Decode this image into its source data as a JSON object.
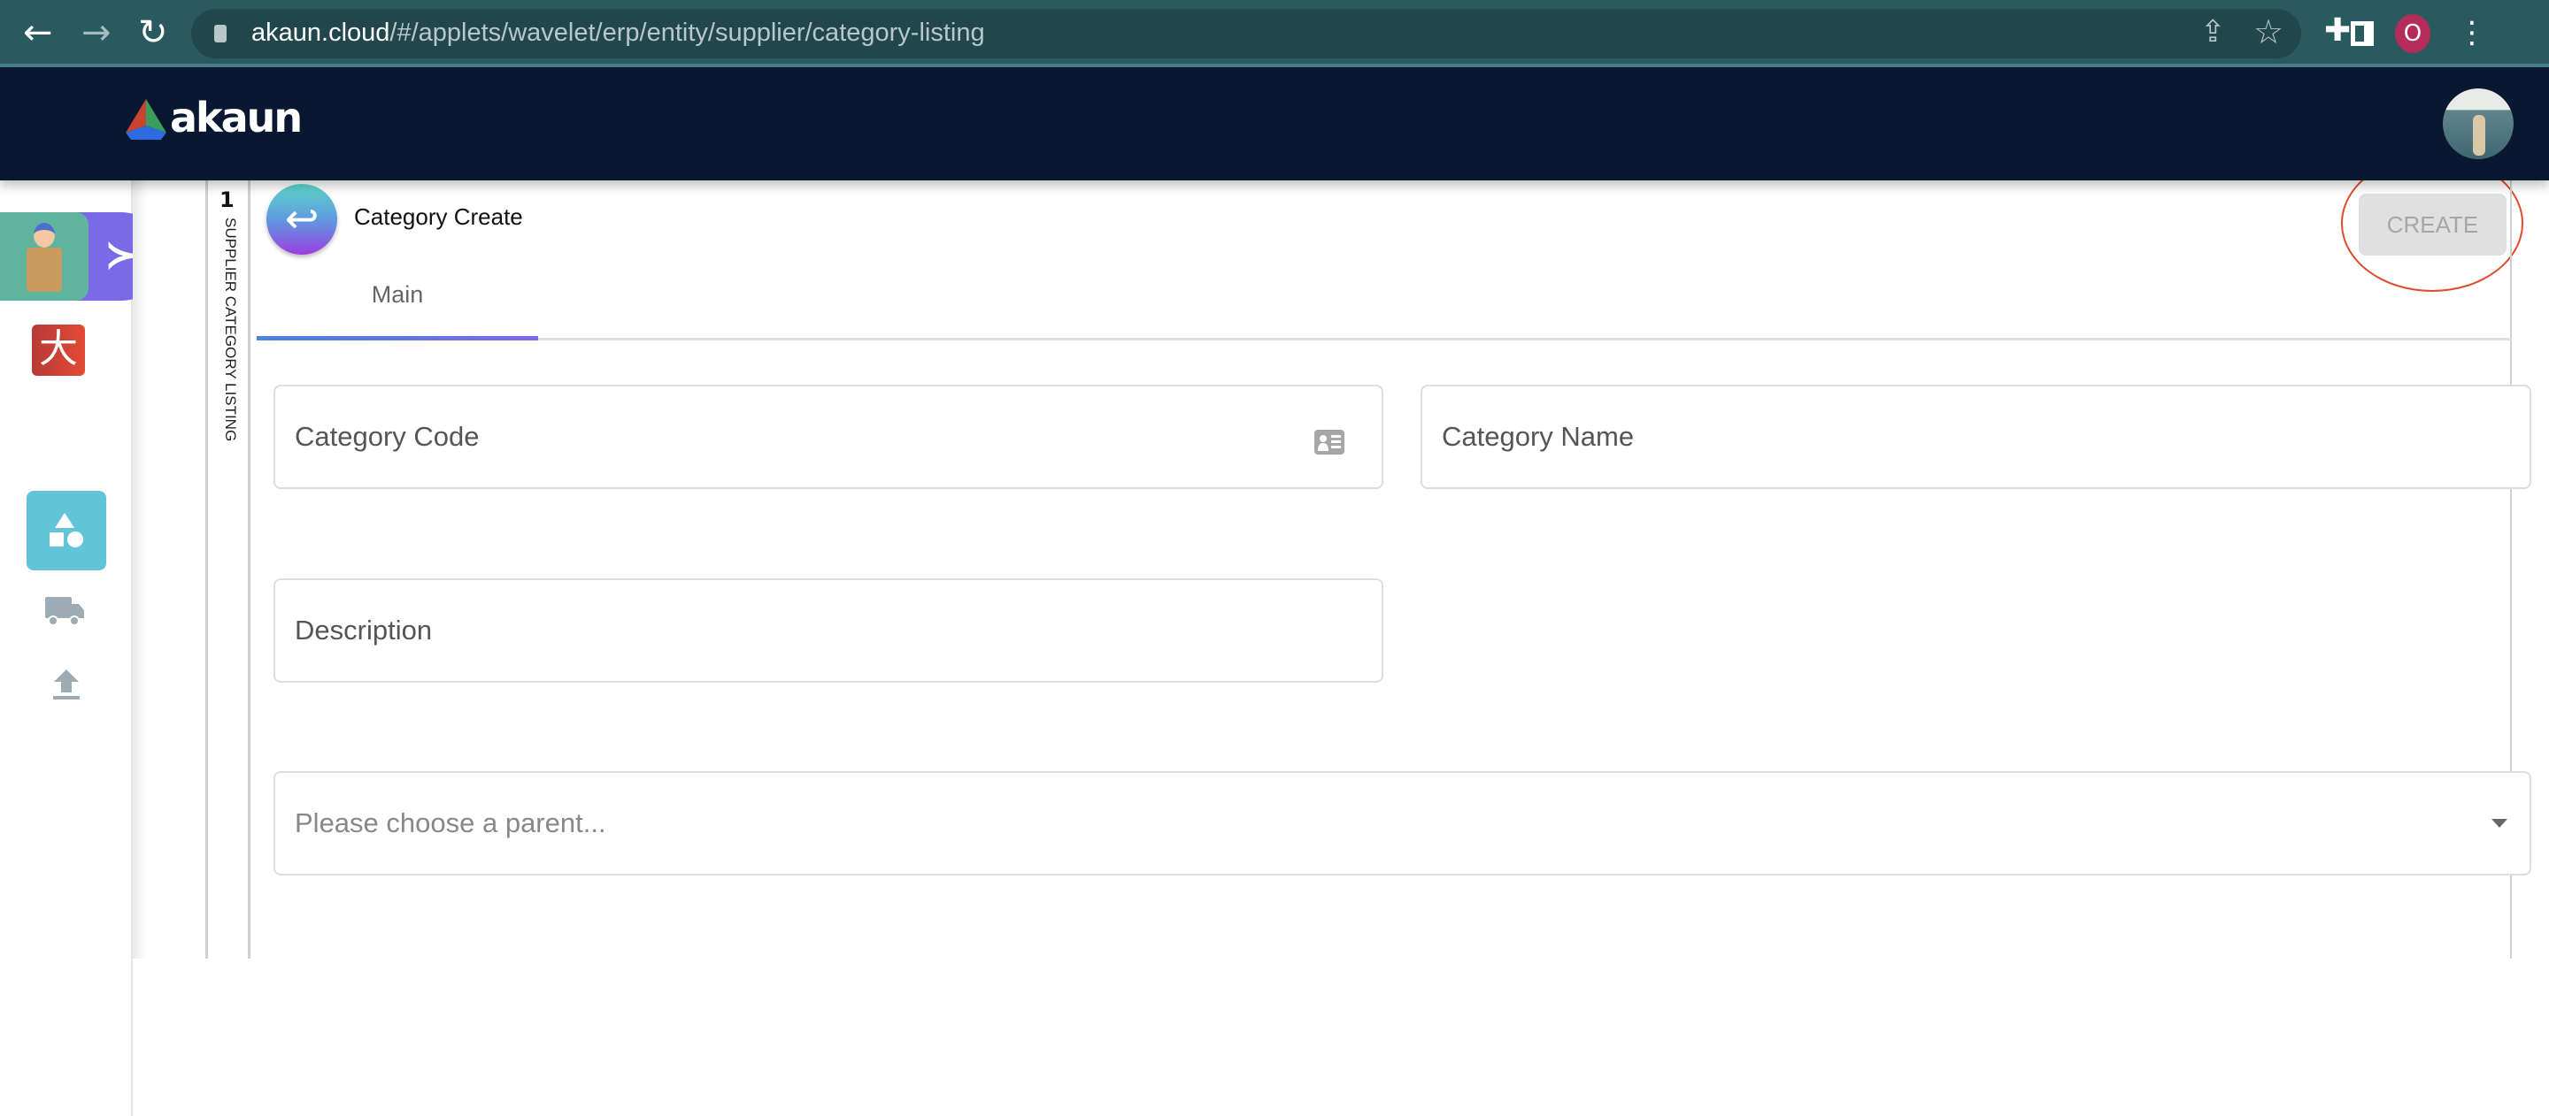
{
  "browser": {
    "url_domain": "akaun.cloud",
    "url_path": "/#/applets/wavelet/erp/entity/supplier/category-listing",
    "profile_initial": "O"
  },
  "header": {
    "logo_text": "akaun"
  },
  "panel": {
    "count": "1",
    "vertical_label": "SUPPLIER CATEGORY LISTING"
  },
  "form": {
    "title": "Category Create",
    "create_label": "CREATE",
    "tabs": [
      {
        "label": "Main"
      }
    ],
    "fields": {
      "category_code": "Category Code",
      "category_name": "Category Name",
      "description": "Description",
      "parent_placeholder": "Please choose a parent..."
    }
  },
  "colors": {
    "header": "#091830",
    "chrome": "#285a60",
    "accent": "#7a6ae6",
    "highlight": "#e0492a"
  }
}
